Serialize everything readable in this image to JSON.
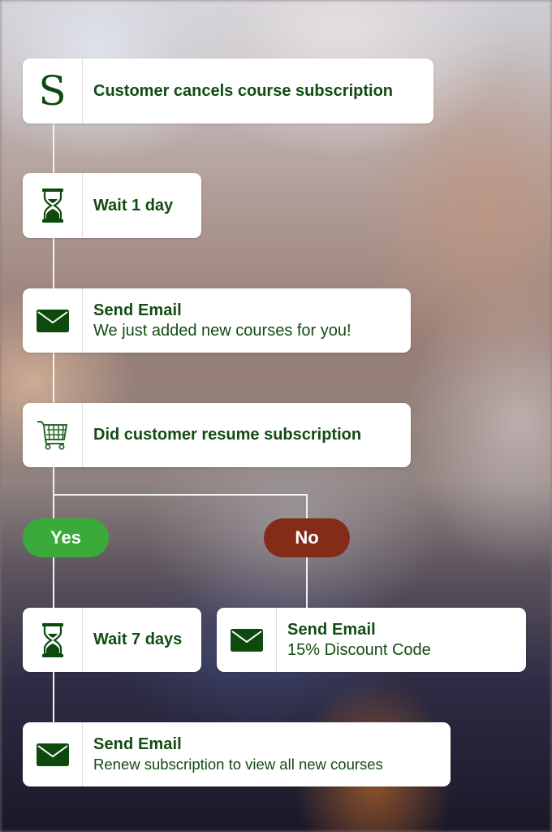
{
  "flow": {
    "trigger": {
      "icon": "subscription-s-icon",
      "label": "Customer cancels course subscription"
    },
    "wait_1": {
      "icon": "hourglass-icon",
      "label": "Wait 1 day"
    },
    "email_1": {
      "icon": "envelope-icon",
      "title": "Send Email",
      "subtitle": "We just added new courses for you!"
    },
    "condition": {
      "icon": "shopping-cart-icon",
      "label": "Did customer resume subscription"
    },
    "branches": {
      "yes": {
        "label": "Yes",
        "color": "#3aaa3a"
      },
      "no": {
        "label": "No",
        "color": "#852c18"
      }
    },
    "yes_wait": {
      "icon": "hourglass-icon",
      "label": "Wait 7 days"
    },
    "no_email": {
      "icon": "envelope-icon",
      "title": "Send Email",
      "subtitle": "15% Discount Code"
    },
    "yes_email": {
      "icon": "envelope-icon",
      "title": "Send Email",
      "subtitle": "Renew subscription to view all new courses"
    }
  },
  "colors": {
    "text_green": "#124c12",
    "icon_green": "#0e4a0e",
    "connector": "#f2f2f2"
  }
}
